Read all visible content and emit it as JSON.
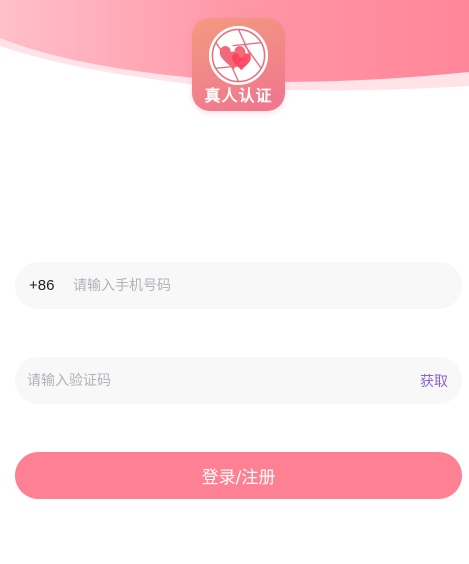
{
  "logo": {
    "text": "真人认证",
    "icon": "heart-aperture-icon"
  },
  "phone_field": {
    "country_code": "+86",
    "placeholder": "请输入手机号码",
    "value": ""
  },
  "code_field": {
    "placeholder": "请输入验证码",
    "value": "",
    "get_code_label": "获取"
  },
  "submit_label": "登录/注册",
  "colors": {
    "accent": "#fe8093",
    "header_pink": "#ff8ea1",
    "get_code": "#8a63d2",
    "field_bg": "#f8f8f9"
  }
}
